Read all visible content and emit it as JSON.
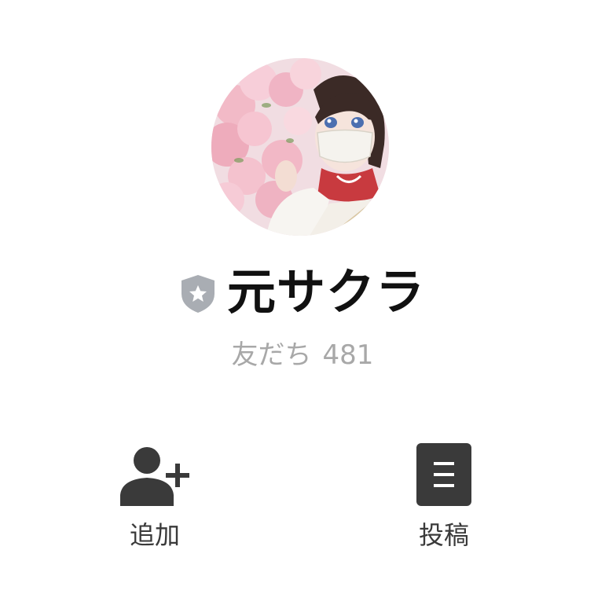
{
  "profile": {
    "name": "元サクラ",
    "friends_label": "友だち",
    "friends_count": "481",
    "badge_icon": "shield-star-icon"
  },
  "actions": [
    {
      "label": "追加",
      "icon": "add-friend-icon"
    },
    {
      "label": "投稿",
      "icon": "post-icon"
    }
  ],
  "colors": {
    "name_text": "#111111",
    "secondary_text": "#a8a8a8",
    "icon_dark": "#3a3a3a",
    "badge_gray": "#a9adb3"
  }
}
